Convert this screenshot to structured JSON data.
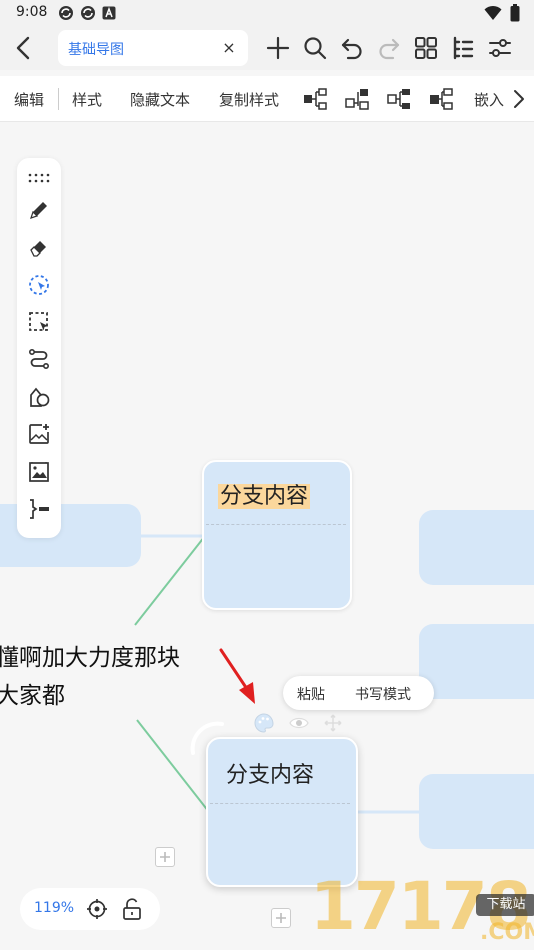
{
  "status": {
    "time": "9:08",
    "left_icons": [
      "sync-icon",
      "sync-icon",
      "a-box-icon"
    ],
    "right_icons": [
      "wifi-icon",
      "battery-icon"
    ]
  },
  "topbar": {
    "tab_title": "基础导图",
    "close_glyph": "×",
    "icons": [
      "plus-icon",
      "search-icon",
      "undo-icon",
      "redo-icon",
      "grid-icon",
      "outline-icon",
      "sliders-icon"
    ]
  },
  "menu": {
    "edit": "编辑",
    "style": "样式",
    "hide_text": "隐藏文本",
    "copy_style": "复制样式",
    "embed": "嵌入",
    "layout_icons": [
      "layout-right-icon",
      "layout-left-icon",
      "layout-tree-icon",
      "layout-org-icon"
    ]
  },
  "tools": [
    "drag-handle-icon",
    "pen-icon",
    "eraser-icon",
    "lasso-icon",
    "select-box-icon",
    "connector-icon",
    "shapes-icon",
    "add-image-icon",
    "image-icon",
    "outline-bracket-icon"
  ],
  "nodes": {
    "upper_title": "分支内容",
    "lower_title": "分支内容"
  },
  "floating_text": {
    "line1": "懂啊加大力度那块",
    "line2": "大家都"
  },
  "popup": {
    "paste": "粘贴",
    "handwriting": "书写模式"
  },
  "zoom": {
    "level": "119%"
  },
  "watermark": {
    "digits": "17178",
    "badge": "下载站",
    "com": ".COM"
  },
  "colors": {
    "accent": "#3477e8",
    "node_fill": "#d6e7f8",
    "highlight": "#fbd79c",
    "connector_green": "#7dcc9e",
    "arrow_red": "#e02020"
  }
}
